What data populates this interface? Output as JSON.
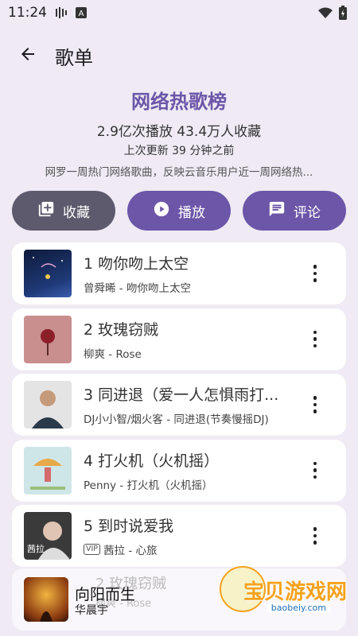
{
  "status": {
    "time": "11:24"
  },
  "header": {
    "title": "歌单"
  },
  "playlist": {
    "name": "网络热歌榜",
    "stats": "2.9亿次播放 43.4万人收藏",
    "updated": "上次更新 39 分钟之前",
    "description": "网罗一周热门网络歌曲，反映云音乐用户近一周网络热..."
  },
  "actions": {
    "collect": "收藏",
    "play": "播放",
    "comment": "评论"
  },
  "songs": [
    {
      "title": "1 吻你吻上太空",
      "subtitle": "曾舜晞 - 吻你吻上太空",
      "vip": ""
    },
    {
      "title": "2 玫瑰窃贼",
      "subtitle": "柳爽 - Rose",
      "vip": ""
    },
    {
      "title": "3 同进退（爱一人怎惧雨打...",
      "subtitle": "DJ小小智/烟火客 - 同进退(节奏慢摇DJ)",
      "vip": ""
    },
    {
      "title": "4 打火机（火机摇）",
      "subtitle": "Penny - 打火机（火机摇）",
      "vip": ""
    },
    {
      "title": "5 到时说爱我",
      "subtitle": "茜拉 - 心旅",
      "vip": "VIP"
    }
  ],
  "ghost_row": {
    "title": "2 玫瑰窃贼",
    "subtitle": "柳爽 - Rose"
  },
  "mini_player": {
    "title": "向阳而生",
    "artist": "华晨宇"
  },
  "watermark": {
    "text": "宝贝游戏网",
    "url": "baobeiy.com"
  },
  "colors": {
    "accent": "#6c56a8",
    "background": "#efeaf4",
    "collect_button": "#5e5a6e"
  }
}
